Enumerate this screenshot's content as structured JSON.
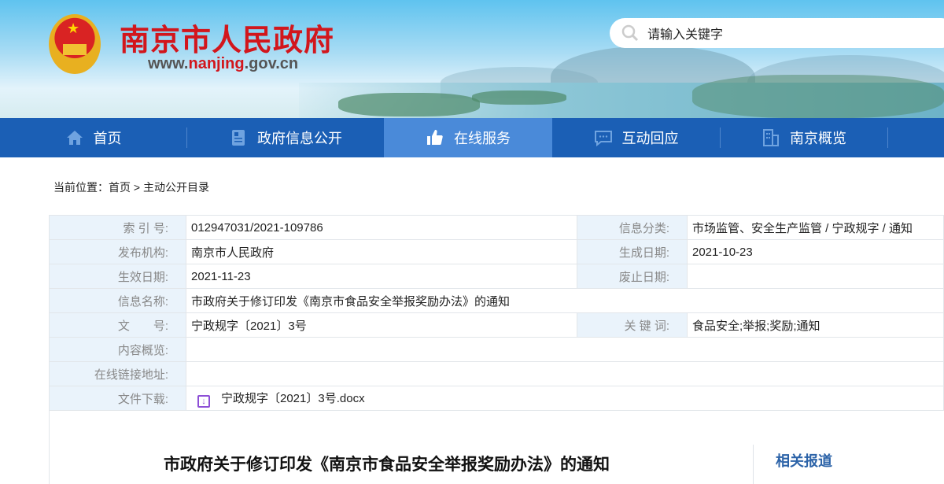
{
  "header": {
    "site_title": "南京市人民政府",
    "url_prefix": "www.",
    "url_highlight": "nanjing",
    "url_suffix": ".gov.cn",
    "search_placeholder": "请输入关键字"
  },
  "nav": {
    "items": [
      {
        "label": "首页",
        "icon": "home-icon"
      },
      {
        "label": "政府信息公开",
        "icon": "document-icon"
      },
      {
        "label": "在线服务",
        "icon": "thumbs-up-icon",
        "active": true
      },
      {
        "label": "互动回应",
        "icon": "chat-icon"
      },
      {
        "label": "南京概览",
        "icon": "building-icon"
      }
    ]
  },
  "breadcrumb": {
    "prefix": "当前位置：",
    "home": "首页",
    "sep": ">",
    "current": "主动公开目录"
  },
  "meta": {
    "index_label": "索 引 号:",
    "index": "012947031/2021-109786",
    "category_label": "信息分类:",
    "category": "市场监管、安全生产监管 / 宁政规字 / 通知",
    "publisher_label": "发布机构:",
    "publisher": "南京市人民政府",
    "created_label": "生成日期:",
    "created": "2021-10-23",
    "effective_label": "生效日期:",
    "effective": "2021-11-23",
    "expired_label": "废止日期:",
    "expired": "",
    "name_label": "信息名称:",
    "name": "市政府关于修订印发《南京市食品安全举报奖励办法》的通知",
    "docno_label": "文　　号:",
    "docno": "宁政规字〔2021〕3号",
    "keywords_label": "关 键 词:",
    "keywords": "食品安全;举报;奖励;通知",
    "summary_label": "内容概览:",
    "summary": "",
    "link_label": "在线链接地址:",
    "link": "",
    "download_label": "文件下载:",
    "download": "宁政规字〔2021〕3号.docx"
  },
  "article": {
    "title": "市政府关于修订印发《南京市食品安全举报奖励办法》的通知"
  },
  "sidebar": {
    "title": "相关报道"
  }
}
